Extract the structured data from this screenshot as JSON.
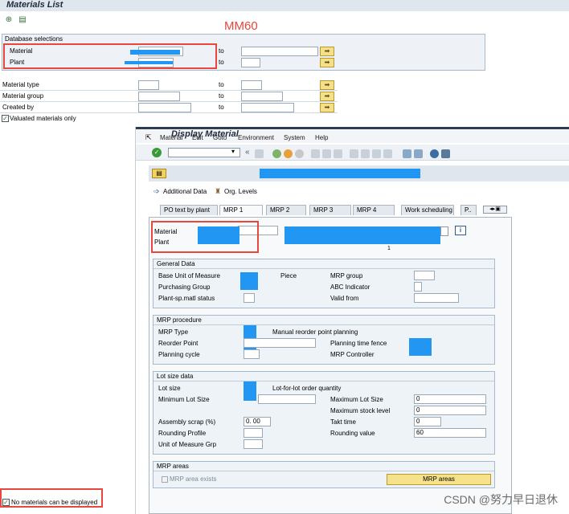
{
  "app": {
    "title": "Materials List",
    "annotation": "MM60"
  },
  "db_selections": {
    "header": "Database selections",
    "rows": [
      {
        "label": "Material",
        "to": "to"
      },
      {
        "label": "Plant",
        "to": "to"
      }
    ]
  },
  "selection_rows": [
    {
      "label": "Material type",
      "to": "to"
    },
    {
      "label": "Material group",
      "to": "to"
    },
    {
      "label": "Created by",
      "to": "to"
    }
  ],
  "valuated": {
    "label": "Valuated materials only",
    "checked": true
  },
  "status": {
    "message": "No materials can be displayed"
  },
  "popup": {
    "menus": [
      "Material",
      "Edit",
      "Goto",
      "Environment",
      "System",
      "Help"
    ],
    "title": "Display Material",
    "app_buttons": {
      "additional": "Additional Data",
      "org": "Org. Levels"
    },
    "tabs": [
      "PO text by plant",
      "MRP 1",
      "MRP 2",
      "MRP 3",
      "MRP 4",
      "Work scheduling",
      "P.."
    ],
    "active_tab": "MRP 1",
    "header_fields": {
      "material": "Material",
      "plant": "Plant",
      "plant_value_hint": "1"
    },
    "general": {
      "title": "General Data",
      "base_uom": "Base Unit of Measure",
      "base_uom_text": "Piece",
      "purchasing_group": "Purchasing Group",
      "plant_status": "Plant-sp.matl status",
      "mrp_group": "MRP group",
      "abc": "ABC Indicator",
      "valid_from": "Valid from"
    },
    "procedure": {
      "title": "MRP procedure",
      "mrp_type": "MRP Type",
      "mrp_type_text": "Manual reorder point planning",
      "reorder_point": "Reorder Point",
      "planning_cycle": "Planning cycle",
      "time_fence": "Planning time fence",
      "controller": "MRP Controller"
    },
    "lotsize": {
      "title": "Lot size data",
      "lot_size": "Lot size",
      "lot_size_text": "Lot-for-lot order quantity",
      "min_lot": "Minimum Lot Size",
      "max_lot": "Maximum Lot Size",
      "max_lot_val": "0",
      "max_stock": "Maximum stock level",
      "max_stock_val": "0",
      "assembly_scrap": "Assembly scrap (%)",
      "assembly_scrap_val": "0. 00",
      "takt": "Takt time",
      "takt_val": "0",
      "rounding_profile": "Rounding Profile",
      "rounding_value": "Rounding value",
      "rounding_value_val": "60",
      "uom_grp": "Unit of Measure Grp"
    },
    "areas": {
      "title": "MRP areas",
      "exists": "MRP area exists",
      "button": "MRP areas"
    }
  },
  "watermark": "CSDN @努力早日退休",
  "colors": {
    "redact": "#2196f3",
    "highlight": "#e8463e",
    "button_yellow": "#f4e08a"
  }
}
